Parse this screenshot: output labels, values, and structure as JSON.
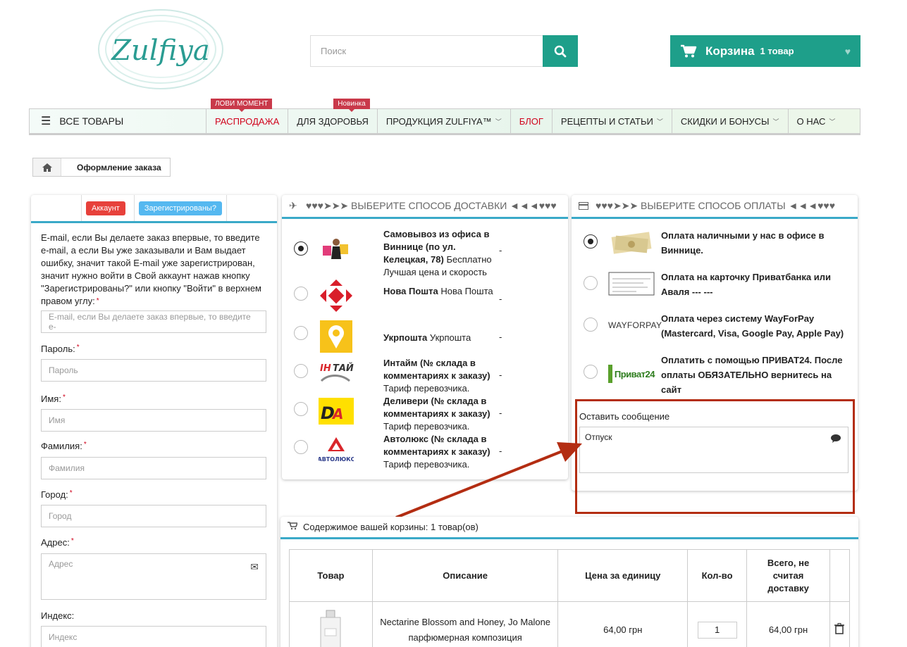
{
  "header": {
    "logo_text": "Zulfiya",
    "search_placeholder": "Поиск",
    "cart_label": "Корзина",
    "cart_count": "1 товар"
  },
  "nav": {
    "all_products": "ВСЕ ТОВАРЫ",
    "items": [
      {
        "label": "РАСПРОДАЖА",
        "badge": "ЛОВИ МОМЕНТ"
      },
      {
        "label": "ДЛЯ ЗДОРОВЬЯ",
        "badge": "Новинка"
      },
      {
        "label": "ПРОДУКЦИЯ ZULFIYA™"
      },
      {
        "label": "БЛОГ"
      },
      {
        "label": "РЕЦЕПТЫ И СТАТЬИ"
      },
      {
        "label": "СКИДКИ И БОНУСЫ"
      },
      {
        "label": "О НАС"
      }
    ]
  },
  "breadcrumb": {
    "current": "Оформление заказа"
  },
  "account": {
    "tab_account": "Аккаунт",
    "tab_registered": "Зарегистрированы?",
    "intro": "E-mail, если Вы делаете заказ впервые, то введите e-mail, а если Вы уже заказывали и Вам выдает ошибку, значит такой E-mail уже зарегистрирован, значит нужно войти в Свой аккаунт нажав кнопку \"Зарегистрированы?\" или кнопку \"Войти\" в верхнем правом углу:",
    "email_placeholder": "E-mail, если Вы делаете заказ впервые, то введите e-",
    "password_label": "Пароль:",
    "password_placeholder": "Пароль",
    "name_label": "Имя:",
    "name_placeholder": "Имя",
    "surname_label": "Фамилия:",
    "surname_placeholder": "Фамилия",
    "city_label": "Город:",
    "city_placeholder": "Город",
    "address_label": "Адрес:",
    "address_placeholder": "Адрес",
    "index_label": "Индекс:",
    "index_placeholder": "Индекс"
  },
  "delivery": {
    "title": "♥♥♥➤➤➤ ВЫБЕРИТЕ СПОСОБ ДОСТАВКИ ◄◄◄♥♥♥",
    "options": [
      {
        "name": "Самовывоз из офиса в Виннице (по ул. Келецкая, 78)",
        "extra": "Бесплатно",
        "note": "Лучшая цена и скорость",
        "price": "-",
        "selected": true
      },
      {
        "name": "Нова Пошта",
        "extra": "Нова Пошта",
        "note": "",
        "price": "-",
        "selected": false
      },
      {
        "name": "Укрпошта",
        "extra": "Укрпошта",
        "note": "",
        "price": "-",
        "selected": false
      },
      {
        "name": "Интайм (№ склада в комментариях к заказу)",
        "extra": "",
        "note": "Тариф перевозчика.",
        "price": "-",
        "selected": false
      },
      {
        "name": "Деливери (№ склада в комментариях к заказу)",
        "extra": "",
        "note": "Тариф перевозчика.",
        "price": "-",
        "selected": false
      },
      {
        "name": "Автолюкс (№ склада в комментариях к заказу)",
        "extra": "",
        "note": "Тариф перевозчика.",
        "price": "-",
        "selected": false
      }
    ]
  },
  "payment": {
    "title": "♥♥♥➤➤➤ ВЫБЕРИТЕ СПОСОБ ОПЛАТЫ ◄◄◄♥♥♥",
    "options": [
      {
        "label": "Оплата наличными у нас в офисе в Виннице.",
        "selected": true
      },
      {
        "label": "Оплата на карточку Приватбанка или Аваля --- ---",
        "selected": false
      },
      {
        "label": "Оплата через систему WayForPay (Mastercard, Visa, Google Pay, Apple Pay)",
        "selected": false
      },
      {
        "label": "Оплатить с помощью ПРИВАТ24. После оплаты ОБЯЗАТЕЛЬНО вернитесь на сайт",
        "selected": false
      }
    ],
    "wayforpay_logo": "WAYFORPAY",
    "privat_logo": "Приват24",
    "message_label": "Оставить сообщение",
    "message_value": "Отпуск"
  },
  "cart": {
    "title": "Содержимое вашей корзины: 1 товар(ов)",
    "columns": [
      "Товар",
      "Описание",
      "Цена за единицу",
      "Кол-во",
      "Всего, не считая доставку"
    ],
    "rows": [
      {
        "description": "Nectarine Blossom and Honey, Jo Malone парфюмерная композиция",
        "price": "64,00 грн",
        "qty": "1",
        "total": "64,00 грн"
      }
    ]
  },
  "colors": {
    "brand": "#1e9f8a",
    "accent_line": "#3aa9c8",
    "sale_red": "#d0021b",
    "annotation": "#b32d12"
  }
}
